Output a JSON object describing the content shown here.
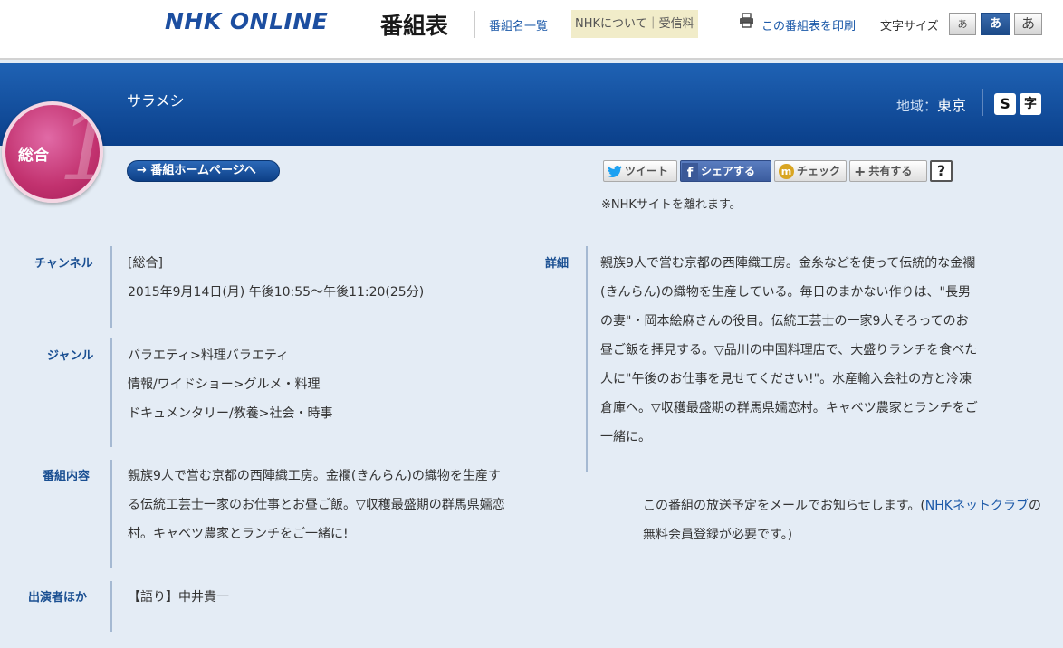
{
  "header": {
    "logo": "NHK ONLINE",
    "logo_sub": "番組表",
    "nav_programs": "番組名一覧",
    "nav_about": "NHKについて｜受信料",
    "print_label": "この番組表を印刷",
    "fontsize_label": "文字サイズ",
    "fontsize_buttons": [
      "あ",
      "あ",
      "あ"
    ],
    "icons": {
      "print": "printer-icon"
    }
  },
  "program": {
    "title": "サラメシ",
    "region_label": "地域：",
    "region_value": "東京",
    "badge_s": "S",
    "badge_ji": "字",
    "channel_name": "総合",
    "channel_number": "1",
    "channel_color": "#c2326f"
  },
  "actions": {
    "home_button": "→ 番組ホームページへ",
    "tweet": "ツイート",
    "share": "シェアする",
    "check": "チェック",
    "kyoyu": "共有する",
    "help": "?",
    "leave_note": "※NHKサイトを離れます。"
  },
  "info": {
    "channel_label": "チャンネル",
    "channel_value": "[総合]",
    "datetime": "2015年9月14日(月) 午後10:55～午後11:20(25分)",
    "genre_label": "ジャンル",
    "genres": [
      "バラエティ>料理バラエティ",
      "情報/ワイドショー>グルメ・料理",
      "ドキュメンタリー/教養>社会・時事"
    ],
    "content_label": "番組内容",
    "content_lines": [
      "親族9人で営む京都の西陣織工房。金襴(きんらん)の織物を生産す",
      "る伝統工芸士一家のお仕事とお昼ご飯。▽収穫最盛期の群馬県嬬恋",
      "村。キャベツ農家とランチをご一緒に!"
    ],
    "cast_label": "出演者ほか",
    "cast_value": "【語り】中井貴一",
    "detail_label": "詳細",
    "detail_lines": [
      "親族9人で営む京都の西陣織工房。金糸などを使って伝統的な金襴",
      "(きんらん)の織物を生産している。毎日のまかない作りは、\"長男",
      "の妻\"・岡本絵麻さんの役目。伝統工芸士の一家9人そろってのお",
      "昼ご飯を拝見する。▽品川の中国料理店で、大盛りランチを食べた",
      "人に\"午後のお仕事を見せてください!\"。水産輸入会社の方と冷凍",
      "倉庫へ。▽収穫最盛期の群馬県嬬恋村。キャベツ農家とランチをご",
      "一緒に。"
    ],
    "mail_note_1": "この番組の放送予定をメールでお知らせします。(",
    "mail_link": "NHKネットクラブ",
    "mail_note_2": "の",
    "mail_note_3": "無料会員登録が必要です。)"
  }
}
